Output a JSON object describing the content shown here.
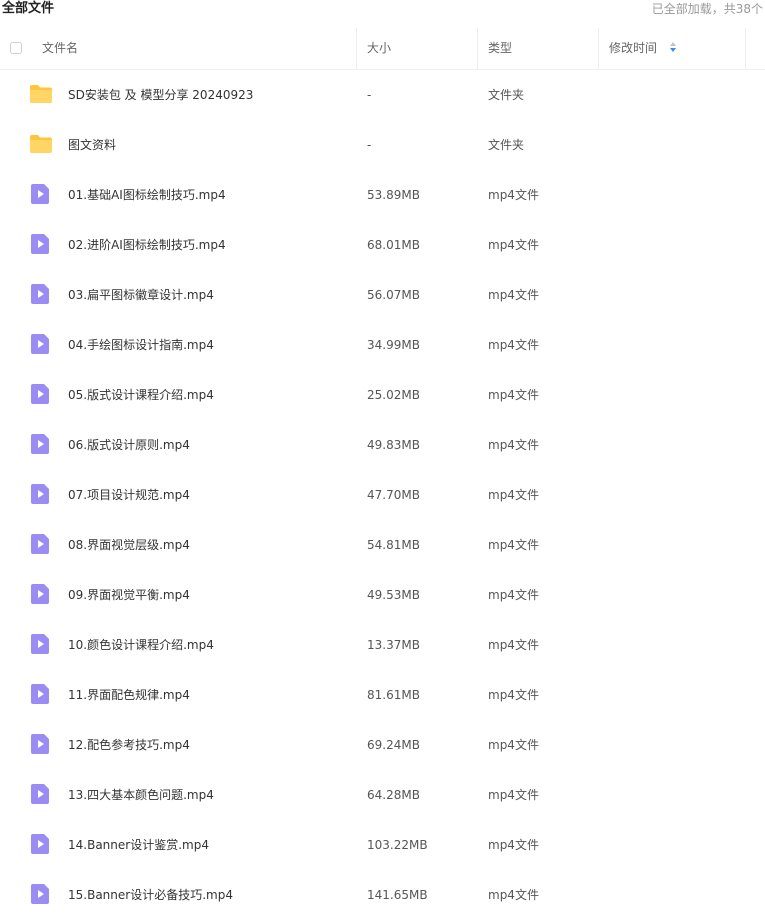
{
  "header": {
    "title": "全部文件",
    "status": "已全部加载，共38个"
  },
  "columns": {
    "name": "文件名",
    "size": "大小",
    "type": "类型",
    "modified": "修改时间"
  },
  "files": [
    {
      "name": "SD安装包 及 模型分享 20240923",
      "size": "-",
      "type": "文件夹",
      "icon": "folder-icon"
    },
    {
      "name": "图文资料",
      "size": "-",
      "type": "文件夹",
      "icon": "folder-icon"
    },
    {
      "name": "01.基础AI图标绘制技巧.mp4",
      "size": "53.89MB",
      "type": "mp4文件",
      "icon": "video-file-icon"
    },
    {
      "name": "02.进阶AI图标绘制技巧.mp4",
      "size": "68.01MB",
      "type": "mp4文件",
      "icon": "video-file-icon"
    },
    {
      "name": "03.扁平图标徽章设计.mp4",
      "size": "56.07MB",
      "type": "mp4文件",
      "icon": "video-file-icon"
    },
    {
      "name": "04.手绘图标设计指南.mp4",
      "size": "34.99MB",
      "type": "mp4文件",
      "icon": "video-file-icon"
    },
    {
      "name": "05.版式设计课程介绍.mp4",
      "size": "25.02MB",
      "type": "mp4文件",
      "icon": "video-file-icon"
    },
    {
      "name": "06.版式设计原则.mp4",
      "size": "49.83MB",
      "type": "mp4文件",
      "icon": "video-file-icon"
    },
    {
      "name": "07.项目设计规范.mp4",
      "size": "47.70MB",
      "type": "mp4文件",
      "icon": "video-file-icon"
    },
    {
      "name": "08.界面视觉层级.mp4",
      "size": "54.81MB",
      "type": "mp4文件",
      "icon": "video-file-icon"
    },
    {
      "name": "09.界面视觉平衡.mp4",
      "size": "49.53MB",
      "type": "mp4文件",
      "icon": "video-file-icon"
    },
    {
      "name": "10.颜色设计课程介绍.mp4",
      "size": "13.37MB",
      "type": "mp4文件",
      "icon": "video-file-icon"
    },
    {
      "name": "11.界面配色规律.mp4",
      "size": "81.61MB",
      "type": "mp4文件",
      "icon": "video-file-icon"
    },
    {
      "name": "12.配色参考技巧.mp4",
      "size": "69.24MB",
      "type": "mp4文件",
      "icon": "video-file-icon"
    },
    {
      "name": "13.四大基本颜色问题.mp4",
      "size": "64.28MB",
      "type": "mp4文件",
      "icon": "video-file-icon"
    },
    {
      "name": "14.Banner设计鉴赏.mp4",
      "size": "103.22MB",
      "type": "mp4文件",
      "icon": "video-file-icon"
    },
    {
      "name": "15.Banner设计必备技巧.mp4",
      "size": "141.65MB",
      "type": "mp4文件",
      "icon": "video-file-icon"
    }
  ],
  "colors": {
    "folder": "#ffc53d",
    "video": "#9b8cf3",
    "sort_active": "#3a8ee6"
  }
}
